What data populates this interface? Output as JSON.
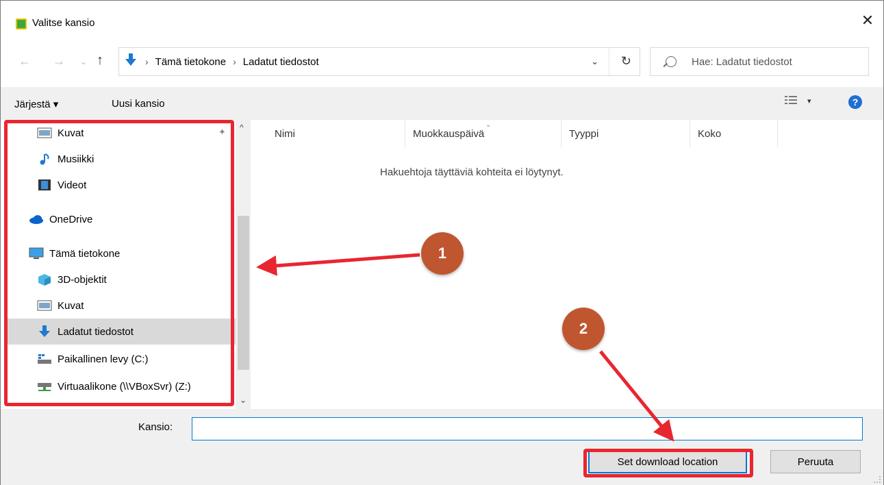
{
  "window": {
    "title": "Valitse kansio",
    "close_glyph": "✕"
  },
  "nav": {
    "back_glyph": "←",
    "forward_glyph": "→",
    "recent_glyph": "⌄",
    "up_glyph": "↑"
  },
  "address": {
    "crumbs": [
      "Tämä tietokone",
      "Ladatut tiedostot"
    ],
    "dropdown_glyph": "⌄",
    "refresh_glyph": "↻"
  },
  "search": {
    "placeholder": "Hae: Ladatut tiedostot"
  },
  "toolbar": {
    "organize_label": "Järjestä ▾",
    "new_folder_label": "Uusi kansio",
    "view_dropdown_glyph": "▾",
    "help_glyph": "?"
  },
  "sidebar": {
    "items": [
      {
        "label": "Kuvat",
        "icon": "pictures-icon",
        "selected": false
      },
      {
        "label": "Musiikki",
        "icon": "music-icon",
        "selected": false
      },
      {
        "label": "Videot",
        "icon": "videos-icon",
        "selected": false
      },
      {
        "label": "OneDrive",
        "icon": "onedrive-icon",
        "selected": false
      },
      {
        "label": "Tämä tietokone",
        "icon": "computer-icon",
        "selected": false
      },
      {
        "label": "3D-objektit",
        "icon": "3d-objects-icon",
        "selected": false
      },
      {
        "label": "Kuvat",
        "icon": "pictures-icon",
        "selected": false
      },
      {
        "label": "Ladatut tiedostot",
        "icon": "downloads-icon",
        "selected": true
      },
      {
        "label": "Paikallinen levy (C:)",
        "icon": "local-disk-icon",
        "selected": false
      },
      {
        "label": "Virtuaalikone (\\\\VBoxSvr) (Z:)",
        "icon": "network-drive-icon",
        "selected": false
      }
    ]
  },
  "filelist": {
    "columns": [
      "Nimi",
      "Muokkauspäivä",
      "Tyyppi",
      "Koko"
    ],
    "empty_message": "Hakuehtoja täyttäviä kohteita ei löytynyt."
  },
  "footer": {
    "folder_label": "Kansio:",
    "folder_value": "",
    "primary_label": "Set download location",
    "cancel_label": "Peruuta"
  },
  "annotations": {
    "badge1": "1",
    "badge2": "2",
    "color": "#e8262f"
  }
}
